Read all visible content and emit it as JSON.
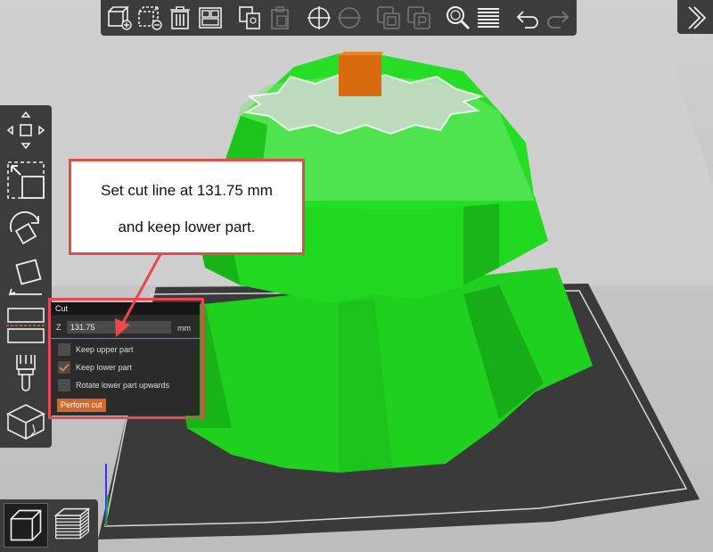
{
  "instruction": {
    "line1": "Set cut line at 131.75 mm",
    "line2": "and keep lower part."
  },
  "cut_panel": {
    "title": "Cut",
    "z_label": "Z",
    "z_value": "131.75",
    "unit": "mm",
    "options": [
      {
        "label": "Keep upper part",
        "checked": false
      },
      {
        "label": "Keep lower part",
        "checked": true
      },
      {
        "label": "Rotate lower part upwards",
        "checked": false
      }
    ],
    "perform_label": "Perform cut"
  },
  "top_toolbar": {
    "icons": [
      "add-icon",
      "delete-icon",
      "delete-all-icon",
      "arrange-icon",
      "copy-icon",
      "paste-icon",
      "add-instance-icon",
      "remove-instance-icon",
      "split-objects-icon",
      "split-parts-icon",
      "search-icon",
      "layers-editing-icon",
      "undo-icon",
      "redo-icon"
    ]
  },
  "left_toolbar": {
    "icons": [
      "move-icon",
      "scale-icon",
      "rotate-icon",
      "place-on-face-icon",
      "cut-icon",
      "paint-supports-icon",
      "seam-painting-icon"
    ]
  },
  "colors": {
    "toolbar": "#3c3c3c",
    "accent": "#d0692c",
    "highlight": "#e64a4a",
    "model_green": "#22d622",
    "object_orange": "#d86a10"
  }
}
